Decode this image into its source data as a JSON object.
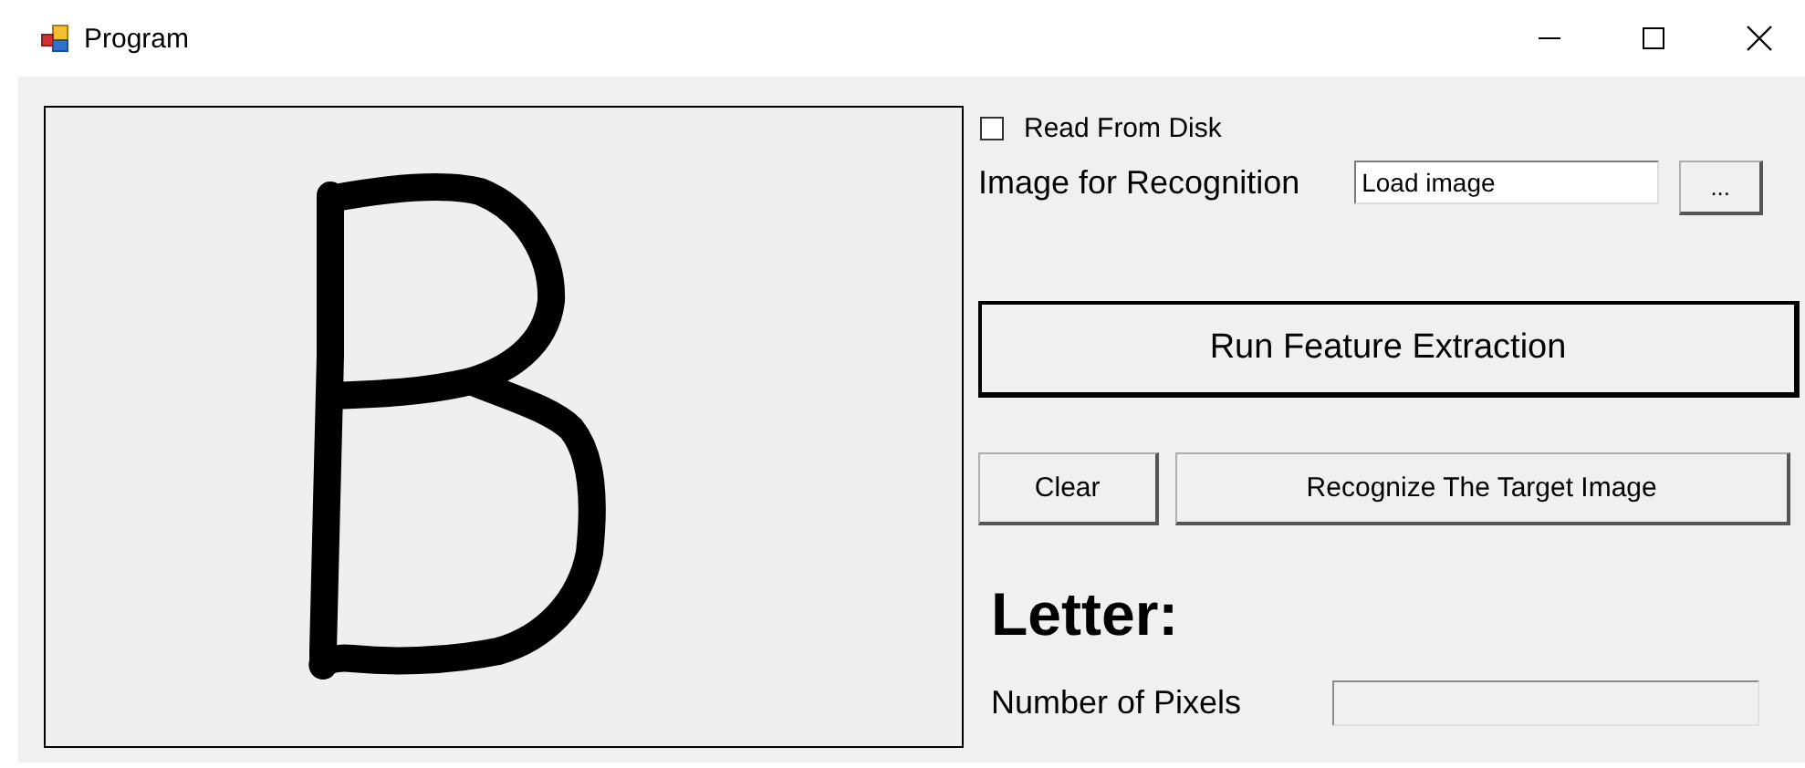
{
  "window": {
    "title": "Program"
  },
  "read_from_disk": {
    "label": "Read From Disk",
    "checked": false
  },
  "image_field": {
    "label": "Image for Recognition",
    "value": "Load image"
  },
  "browse_button": "...",
  "run_button": "Run Feature Extraction",
  "action_buttons": [
    {
      "label": "Clear",
      "kind": "small"
    },
    {
      "label": "Recognize The Target Image",
      "kind": "wide"
    }
  ],
  "letter_label": "Letter:",
  "pixels": {
    "label": "Number of Pixels"
  }
}
